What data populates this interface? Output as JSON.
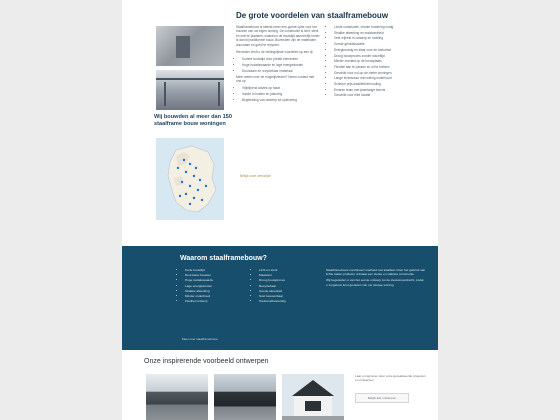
{
  "colors": {
    "navy": "#174e6b",
    "title": "#17324a",
    "accent": "#b78d55",
    "map_land": "#cfe0ec"
  },
  "section_top": {
    "title": "De grote voordelen van staalframebouw",
    "map_title": "Wij bouwden al meer dan 150 staalframe bouw woningen",
    "left_text": "Staalframebouw is steeds meer een goede optie voor het bouwen van uw eigen woning. De constructie is licht, sterk en snel te plaatsen, waardoor de bouwtijd aanzienlijk korter is dan bij traditionele bouw. Bovendien zijn de materialen duurzaam en goed te recyclen.",
    "left_intro_2": "Hieronder vindt u de belangrijkste voordelen op een rij:",
    "left_bullets": [
      "Kortere bouwtijd door prefab elementen",
      "Hoge isolatiewaarde en lage energiekosten",
      "Duurzaam en recyclebaar materiaal"
    ],
    "left_intro_3": "Meer weten over de mogelijkheden? Neem contact met ons op.",
    "left_bullets_2": [
      "Vrijblijvend advies op maat",
      "Inzicht in kosten en planning",
      "Begeleiding van ontwerp tot oplevering"
    ],
    "right_bullets": [
      "Lichte constructie, minder fundering nodig",
      "Strakke afwerking en maatvastheid",
      "Veel vrijheid in ontwerp en indeling",
      "Goede geluidsisolatie",
      "Energiezuinig en klaar voor de toekomst",
      "Droog bouwproces zonder wachttijd",
      "Minder overlast op de bouwplaats",
      "Flexibel aan te passen en uit te breiden",
      "Geschikt voor nul-op-de-meter woningen",
      "Lange levensduur met weinig onderhoud",
      "Scherpe prijs-kwaliteitverhouding",
      "Ervaren team met jarenlange kennis",
      "Geschikt voor elke locatie"
    ],
    "cta": "Bekijk onze werkwijze"
  },
  "band": {
    "title": "Waarom staalframebouw?",
    "col1": [
      "Korte bouwtijd",
      "Duurzaam bouwen",
      "Hoge isolatiewaarde",
      "Lage energiekosten",
      "Strakke afwerking",
      "Minder onderhoud",
      "Flexibel ontwerp"
    ],
    "col2": [
      "Licht en sterk",
      "Maatvast",
      "Droog bouwproces",
      "Recyclebaar",
      "Goede akoestiek",
      "Snel bewoonbaar",
      "Toekomstbestendig"
    ],
    "col3_p1": "Staalframebouw combineert snelheid met kwaliteit. Door het gebruik van lichte stalen profielen ontstaat een sterke en stabiele constructie.",
    "col3_p2": "Wij begeleiden u van het eerste ontwerp tot de sleuteloverdracht, zodat u zorgeloos kunt genieten van uw nieuwe woning.",
    "button": "Meer over staalframebouw"
  },
  "lower": {
    "title": "Onze inspirerende voorbeeld ontwerpen",
    "side_text": "Laat u inspireren door onze gerealiseerde projecten en ontwerpen.",
    "side_button": "Bekijk alle ontwerpen"
  }
}
